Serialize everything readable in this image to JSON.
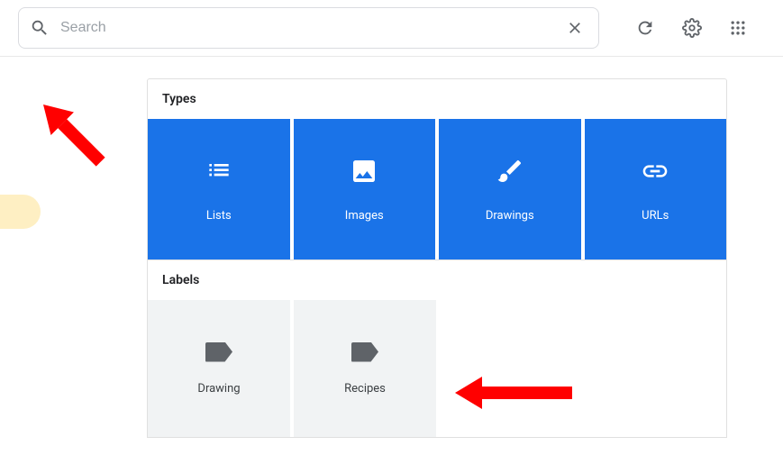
{
  "search": {
    "placeholder": "Search"
  },
  "sections": {
    "types": {
      "title": "Types",
      "items": [
        {
          "label": "Lists"
        },
        {
          "label": "Images"
        },
        {
          "label": "Drawings"
        },
        {
          "label": "URLs"
        }
      ]
    },
    "labels": {
      "title": "Labels",
      "items": [
        {
          "label": "Drawing"
        },
        {
          "label": "Recipes"
        }
      ]
    }
  }
}
